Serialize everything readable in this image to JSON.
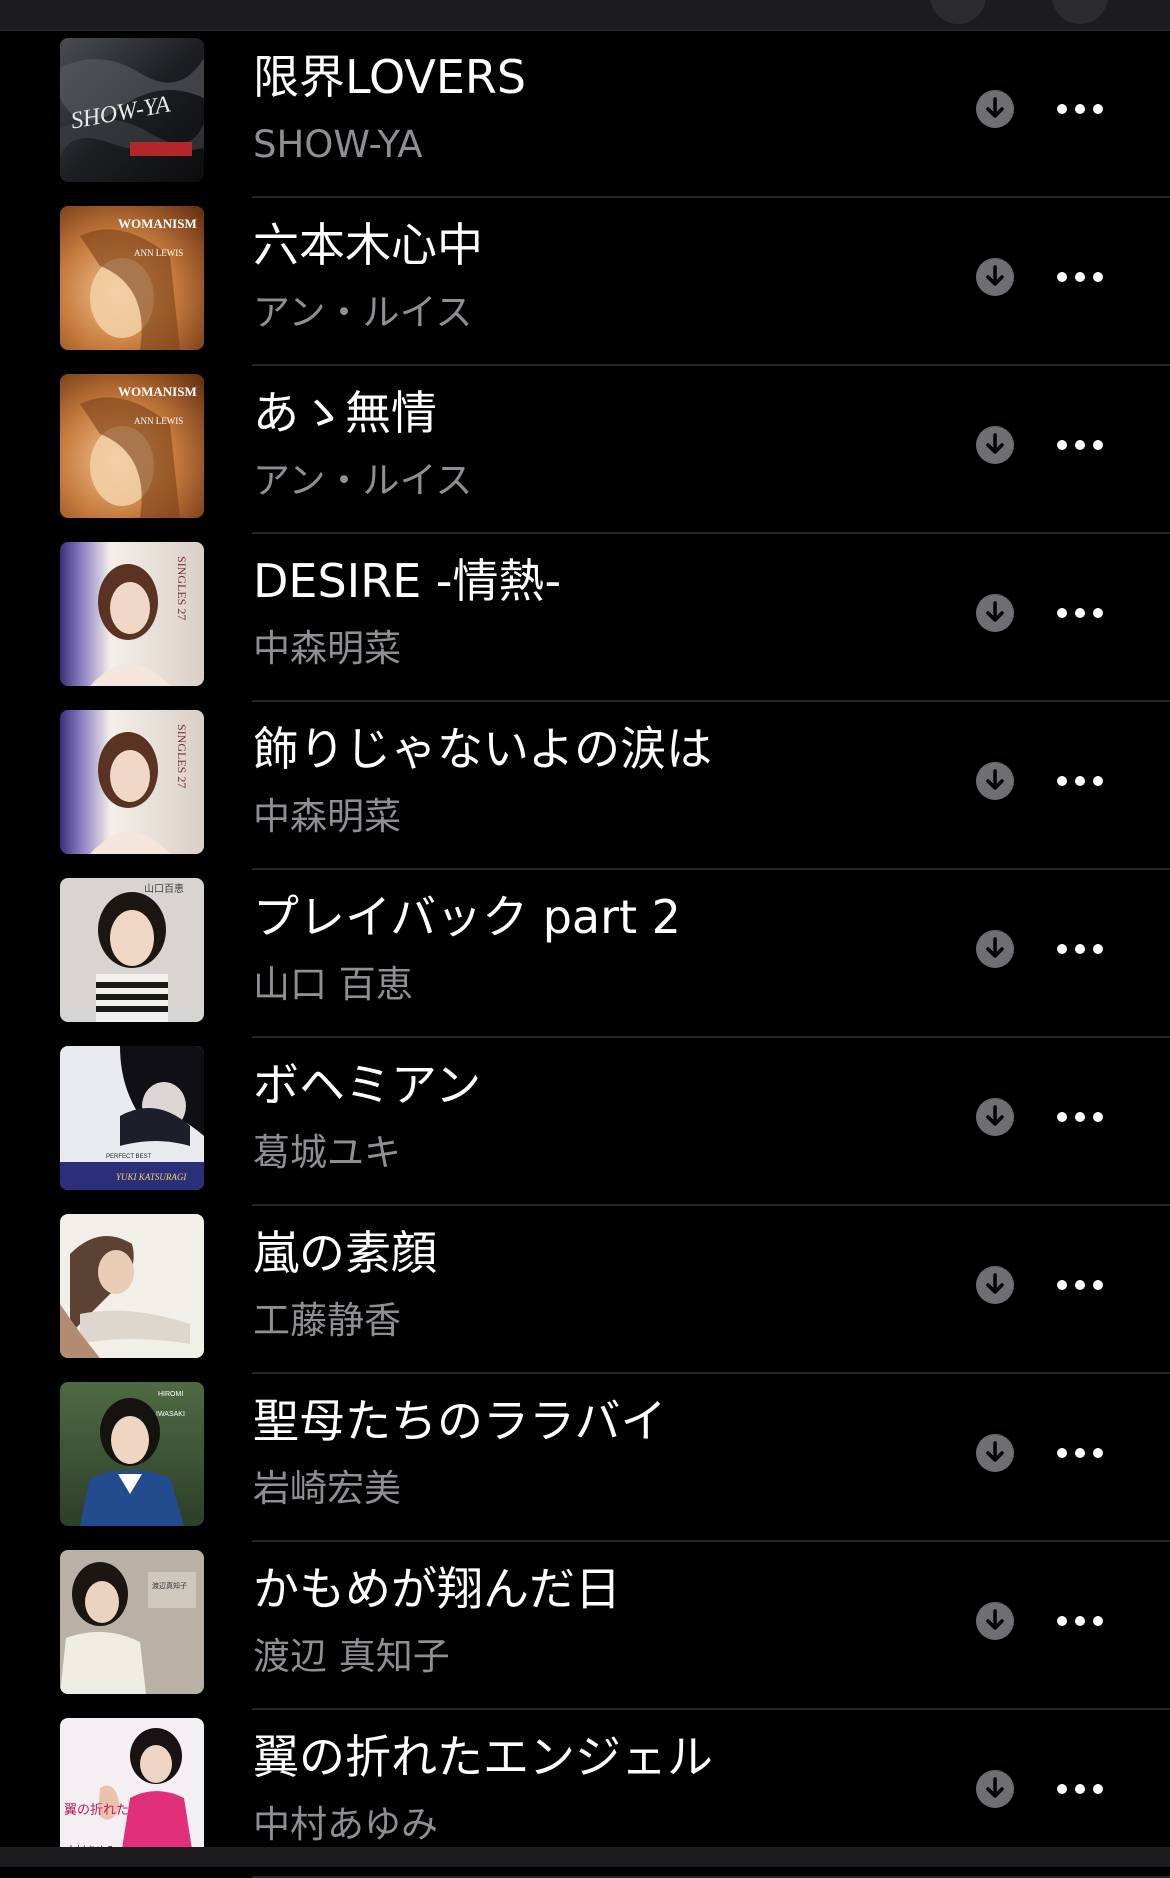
{
  "songs": [
    {
      "title": "限界LOVERS",
      "artist": "SHOW-YA",
      "artwork_icon": "album-art-show-ya",
      "artwork_text": "SHOW-YA"
    },
    {
      "title": "六本木心中",
      "artist": "アン・ルイス",
      "artwork_icon": "album-art-womanism",
      "artwork_text": "WOMANISM"
    },
    {
      "title": "あゝ無情",
      "artist": "アン・ルイス",
      "artwork_icon": "album-art-womanism",
      "artwork_text": "WOMANISM"
    },
    {
      "title": "DESIRE -情熱-",
      "artist": "中森明菜",
      "artwork_icon": "album-art-singles",
      "artwork_text": "SINGLES"
    },
    {
      "title": "飾りじゃないよの涙は",
      "artist": "中森明菜",
      "artwork_icon": "album-art-singles",
      "artwork_text": "SINGLES"
    },
    {
      "title": "プレイバック part 2",
      "artist": "山口 百恵",
      "artwork_icon": "album-art-yamaguchi",
      "artwork_text": "山口百恵"
    },
    {
      "title": "ボヘミアン",
      "artist": "葛城ユキ",
      "artwork_icon": "album-art-perfect-best",
      "artwork_text": "YUKI KATSURAGI"
    },
    {
      "title": "嵐の素顔",
      "artist": "工藤静香",
      "artwork_icon": "album-art-kudo",
      "artwork_text": ""
    },
    {
      "title": "聖母たちのララバイ",
      "artist": "岩崎宏美",
      "artwork_icon": "album-art-iwasaki",
      "artwork_text": "HIROMI IWASAKI"
    },
    {
      "title": "かもめが翔んだ日",
      "artist": "渡辺 真知子",
      "artwork_icon": "album-art-watanabe",
      "artwork_text": ""
    },
    {
      "title": "翼の折れたエンジェル",
      "artist": "中村あゆみ",
      "artwork_icon": "album-art-nakamura",
      "artwork_text": "翼の折れたエンジェル"
    }
  ],
  "icons": {
    "download": "download-icon",
    "more": "more-icon"
  },
  "colors": {
    "background": "#000000",
    "title": "#ffffff",
    "artist": "#8e8e93",
    "separator": "#262628",
    "download_bg": "#6e6e73"
  }
}
